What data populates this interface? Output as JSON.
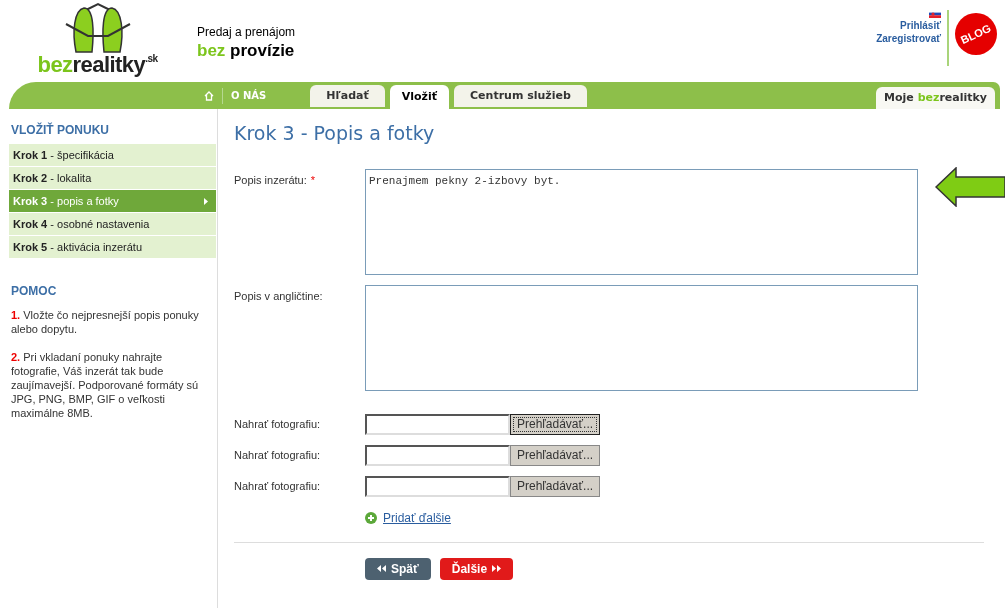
{
  "logo": {
    "part1": "bez",
    "part2": "realitky",
    "suffix": ".sk"
  },
  "tagline": {
    "line1": "Predaj a prenájom",
    "accent": "bez",
    "rest": "provízie"
  },
  "account_links": [
    "Prihlásiť",
    "Zaregistrovať"
  ],
  "blog_badge": "BLOG",
  "nav": {
    "about": "O NÁS",
    "tabs": [
      {
        "label": "Hľadať",
        "selected": false
      },
      {
        "label": "Vložiť",
        "selected": true
      },
      {
        "label": "Centrum služieb",
        "selected": false
      }
    ],
    "account_tab": {
      "prefix": "Moje ",
      "accent": "bez",
      "rest": "realitky"
    }
  },
  "sidebar": {
    "title": "VLOŽIŤ PONUKU",
    "steps": [
      {
        "step": "Krok 1",
        "label": " - špecifikácia",
        "selected": false
      },
      {
        "step": "Krok 2",
        "label": " - lokalita",
        "selected": false
      },
      {
        "step": "Krok 3",
        "label": " - popis a fotky",
        "selected": true
      },
      {
        "step": "Krok 4",
        "label": " - osobné nastavenia",
        "selected": false
      },
      {
        "step": "Krok 5",
        "label": " - aktivácia inzerátu",
        "selected": false
      }
    ],
    "help_title": "POMOC",
    "help": [
      {
        "number": "1.",
        "text": "Vložte čo nejpresnejší popis ponuky alebo dopytu."
      },
      {
        "number": "2.",
        "text": "Pri vkladaní ponuky nahrajte fotografie, Váš inzerát tak bude zaujímavejší. Podporované formáty sú JPG, PNG, BMP, GIF o veľkosti maximálne 8MB."
      }
    ]
  },
  "form": {
    "title": "Krok 3 - Popis a fotky",
    "required_mark": "*",
    "descriptions": [
      {
        "label": "Popis inzerátu:",
        "required": true,
        "value": "Prenajmem pekny 2-izbovy byt.",
        "pointer": true
      },
      {
        "label": "Popis v angličtine:",
        "required": false,
        "pointer": false
      }
    ],
    "uploads": [
      {
        "label": "Nahrať fotografiu:",
        "button": "Prehľadávať...",
        "focused": true
      },
      {
        "label": "Nahrať fotografiu:",
        "button": "Prehľadávať...",
        "focused": false
      },
      {
        "label": "Nahrať fotografiu:",
        "button": "Prehľadávať...",
        "focused": false
      }
    ],
    "add_more": "Pridať ďalšie",
    "buttons": [
      {
        "kind": "back",
        "label": "Späť"
      },
      {
        "kind": "next",
        "label": "Ďalšie"
      }
    ]
  }
}
